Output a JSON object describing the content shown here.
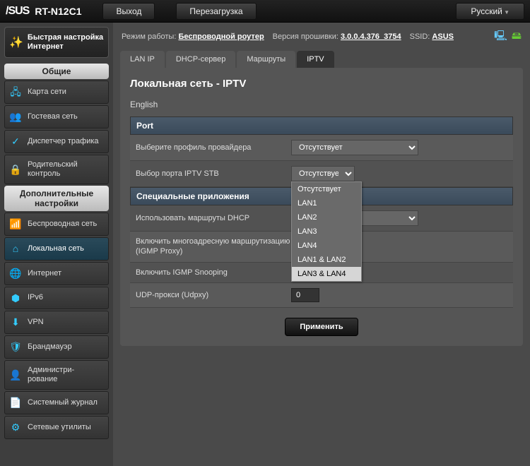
{
  "brand": "/SUS",
  "model": "RT-N12C1",
  "top": {
    "logout": "Выход",
    "reboot": "Перезагрузка",
    "lang": "Русский"
  },
  "info": {
    "mode_lbl": "Режим работы:",
    "mode": "Беспроводной роутер",
    "fw_lbl": "Версия прошивки:",
    "fw": "3.0.0.4.376_3754",
    "ssid_lbl": "SSID:",
    "ssid": "ASUS"
  },
  "qs": "Быстрая настройка Интернет",
  "sections": {
    "general": "Общие",
    "advanced": "Дополнительные настройки"
  },
  "nav_general": [
    {
      "key": "map",
      "label": "Карта сети",
      "icon": "🖧"
    },
    {
      "key": "guest",
      "label": "Гостевая сеть",
      "icon": "👥"
    },
    {
      "key": "traffic",
      "label": "Диспетчер трафика",
      "icon": "✓"
    },
    {
      "key": "parental",
      "label": "Родительский контроль",
      "icon": "🔒"
    }
  ],
  "nav_adv": [
    {
      "key": "wireless",
      "label": "Беспроводная сеть",
      "icon": "📶"
    },
    {
      "key": "lan",
      "label": "Локальная сеть",
      "icon": "⌂",
      "active": true
    },
    {
      "key": "wan",
      "label": "Интернет",
      "icon": "🌐"
    },
    {
      "key": "ipv6",
      "label": "IPv6",
      "icon": "⬢"
    },
    {
      "key": "vpn",
      "label": "VPN",
      "icon": "⬇"
    },
    {
      "key": "fw",
      "label": "Брандмауэр",
      "icon": "🛡"
    },
    {
      "key": "admin",
      "label": "Администри-рование",
      "icon": "👤"
    },
    {
      "key": "log",
      "label": "Системный журнал",
      "icon": "📄"
    },
    {
      "key": "tools",
      "label": "Сетевые утилиты",
      "icon": "⚙"
    }
  ],
  "tabs": [
    {
      "key": "lanip",
      "label": "LAN IP"
    },
    {
      "key": "dhcp",
      "label": "DHCP-сервер"
    },
    {
      "key": "route",
      "label": "Маршруты"
    },
    {
      "key": "iptv",
      "label": "IPTV",
      "active": true
    }
  ],
  "panel": {
    "title": "Локальная сеть - IPTV",
    "sub": "English",
    "port_hdr": "Port",
    "profile_lbl": "Выберите профиль провайдера",
    "profile_val": "Отсутствует",
    "stb_lbl": "Выбор порта IPTV STB",
    "stb_val": "Отсутствует",
    "stb_opts": [
      "Отсутствует",
      "LAN1",
      "LAN2",
      "LAN3",
      "LAN4",
      "LAN1 & LAN2",
      "LAN3 & LAN4"
    ],
    "sp_hdr": "Специальные приложения",
    "dhcp_routes": "Использовать маршруты DHCP",
    "igmp_proxy": "Включить многоадресную маршрутизацию (IGMP Proxy)",
    "igmp_snoop": "Включить IGMP Snooping",
    "udp_lbl": "UDP-прокси (Udpxy)",
    "udp_val": "0",
    "apply": "Применить"
  }
}
